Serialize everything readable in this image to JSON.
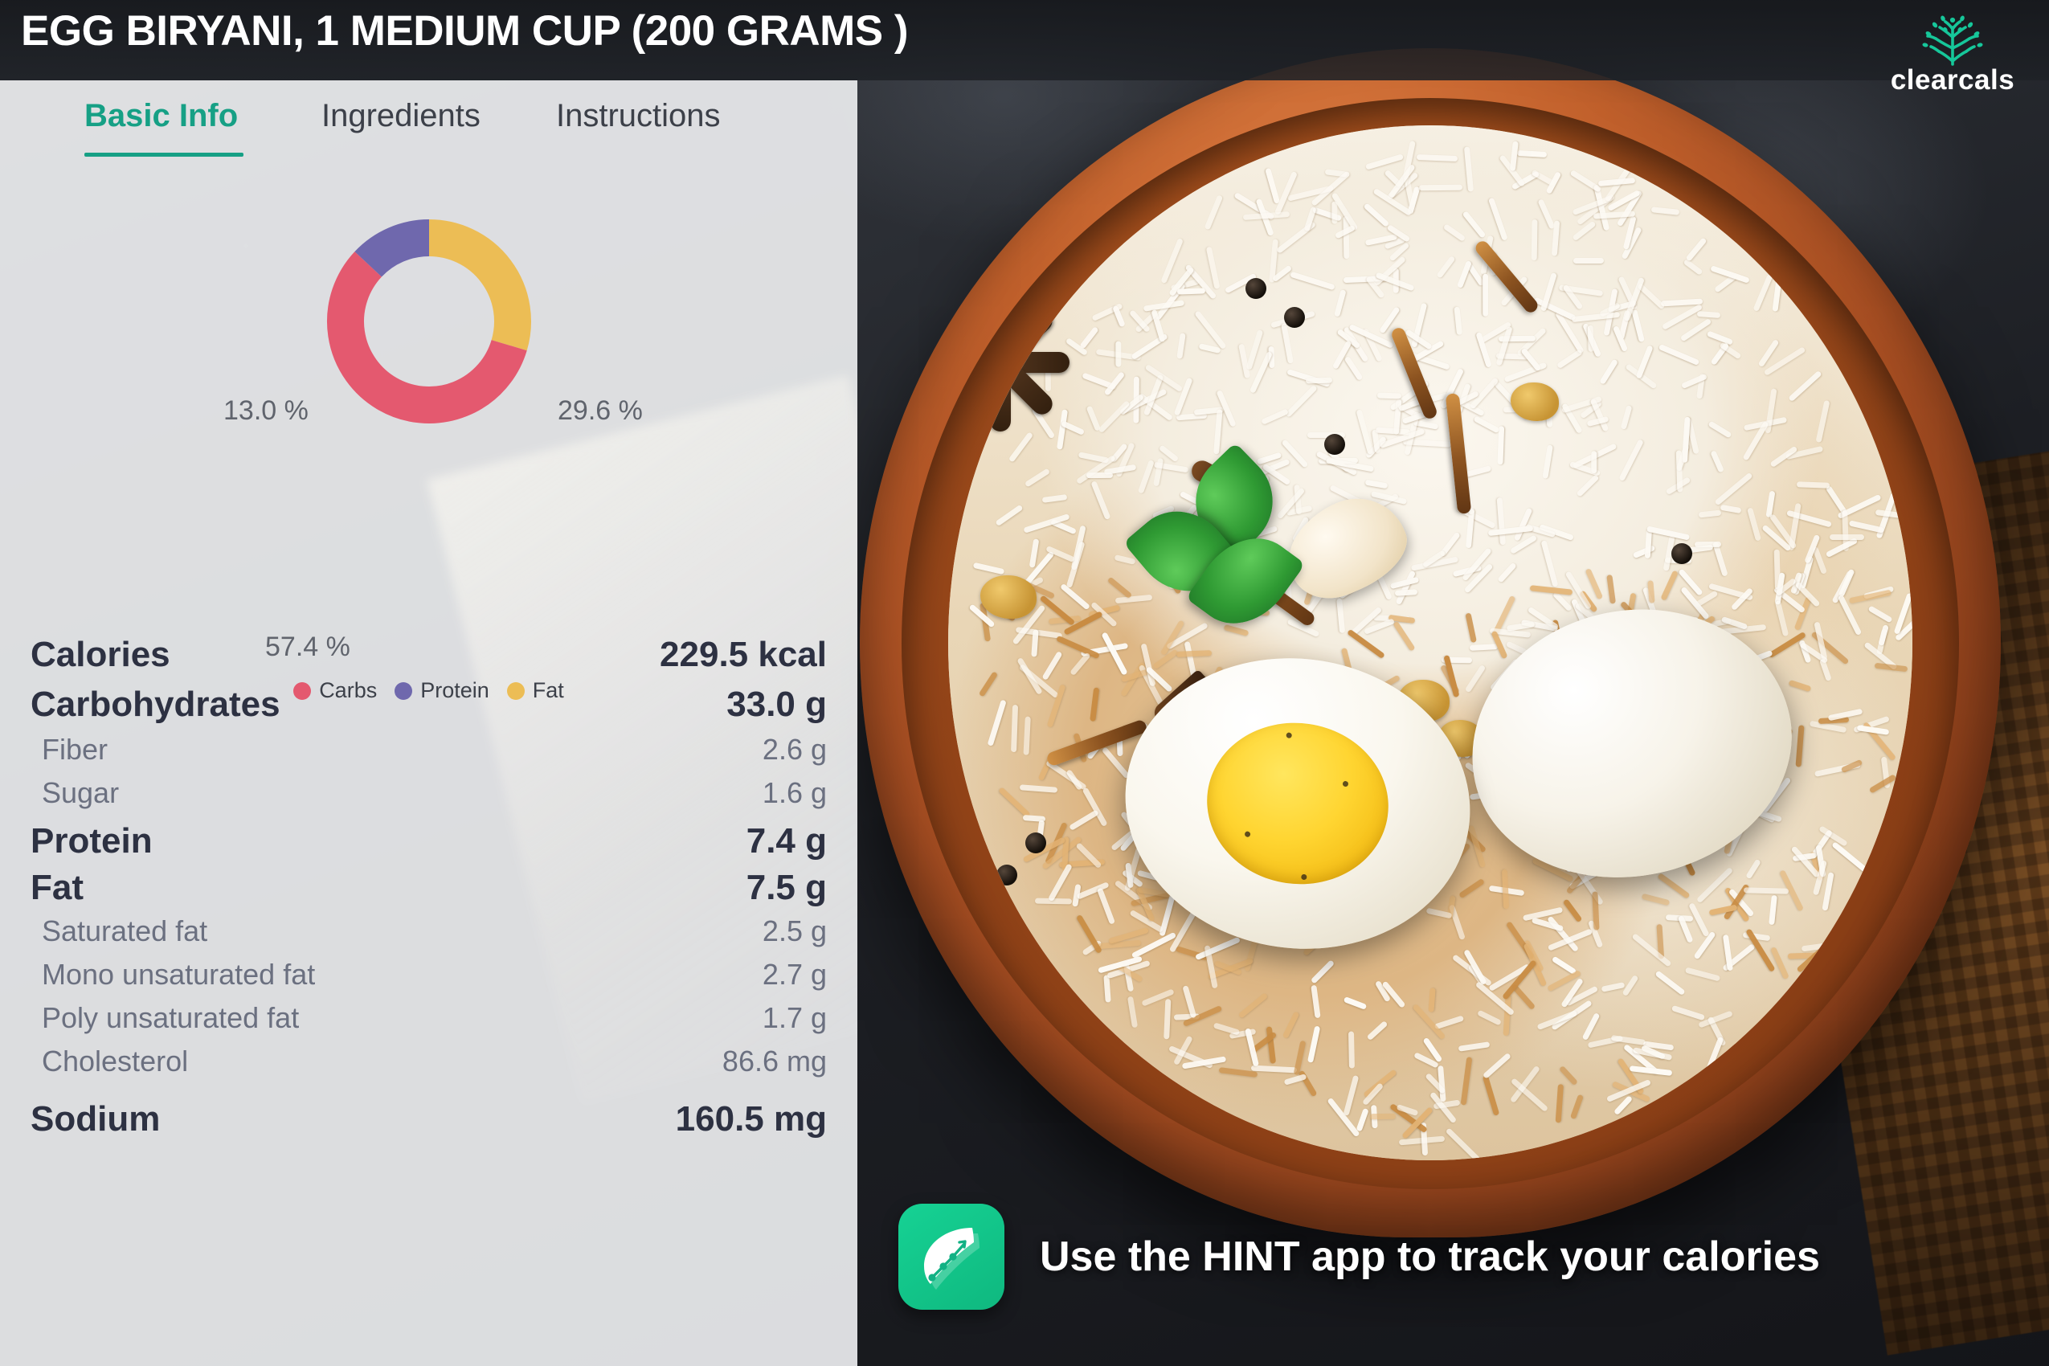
{
  "header": {
    "title": "EGG BIRYANI, 1 MEDIUM CUP (200 GRAMS )",
    "brand": {
      "name": "clearcals",
      "mark_icon": "tree-icon",
      "color": "#16c79a"
    }
  },
  "tabs": [
    {
      "label": "Basic Info",
      "active": true
    },
    {
      "label": "Ingredients",
      "active": false
    },
    {
      "label": "Instructions",
      "active": false
    }
  ],
  "accent_color": "#16a085",
  "chart_data": {
    "type": "pie",
    "title": "",
    "subtype": "donut",
    "categories": [
      "Carbs",
      "Protein",
      "Fat"
    ],
    "values": [
      57.4,
      13.0,
      29.6
    ],
    "labels": [
      "57.4 %",
      "13.0 %",
      "29.6 %"
    ],
    "colors": [
      "#e4596f",
      "#6f68ad",
      "#ecbd55"
    ],
    "unit": "%",
    "legend": [
      "Carbs",
      "Protein",
      "Fat"
    ],
    "legend_position": "bottom",
    "start_angle_deg": 0,
    "direction": "clockwise",
    "order_from_top_clockwise": [
      "Fat",
      "Carbs",
      "Protein"
    ]
  },
  "nutrition": [
    {
      "name": "Calories",
      "value": "229.5 kcal",
      "level": "major"
    },
    {
      "name": "Carbohydrates",
      "value": "33.0 g",
      "level": "major"
    },
    {
      "name": "Fiber",
      "value": "2.6 g",
      "level": "sub"
    },
    {
      "name": "Sugar",
      "value": "1.6 g",
      "level": "sub"
    },
    {
      "name": "Protein",
      "value": "7.4 g",
      "level": "major"
    },
    {
      "name": "Fat",
      "value": "7.5 g",
      "level": "major"
    },
    {
      "name": "Saturated fat",
      "value": "2.5 g",
      "level": "sub"
    },
    {
      "name": "Mono unsaturated fat",
      "value": "2.7 g",
      "level": "sub"
    },
    {
      "name": "Poly unsaturated fat",
      "value": "1.7 g",
      "level": "sub"
    },
    {
      "name": "Cholesterol",
      "value": "86.6 mg",
      "level": "sub"
    },
    {
      "name": "Sodium",
      "value": "160.5 mg",
      "level": "major"
    }
  ],
  "promo": {
    "text": "Use the HINT app to track your calories",
    "app_icon": "leaf-chart-icon",
    "icon_color": "#12c58b"
  },
  "photo": {
    "alt_name": "egg-biryani-bowl-photo"
  }
}
